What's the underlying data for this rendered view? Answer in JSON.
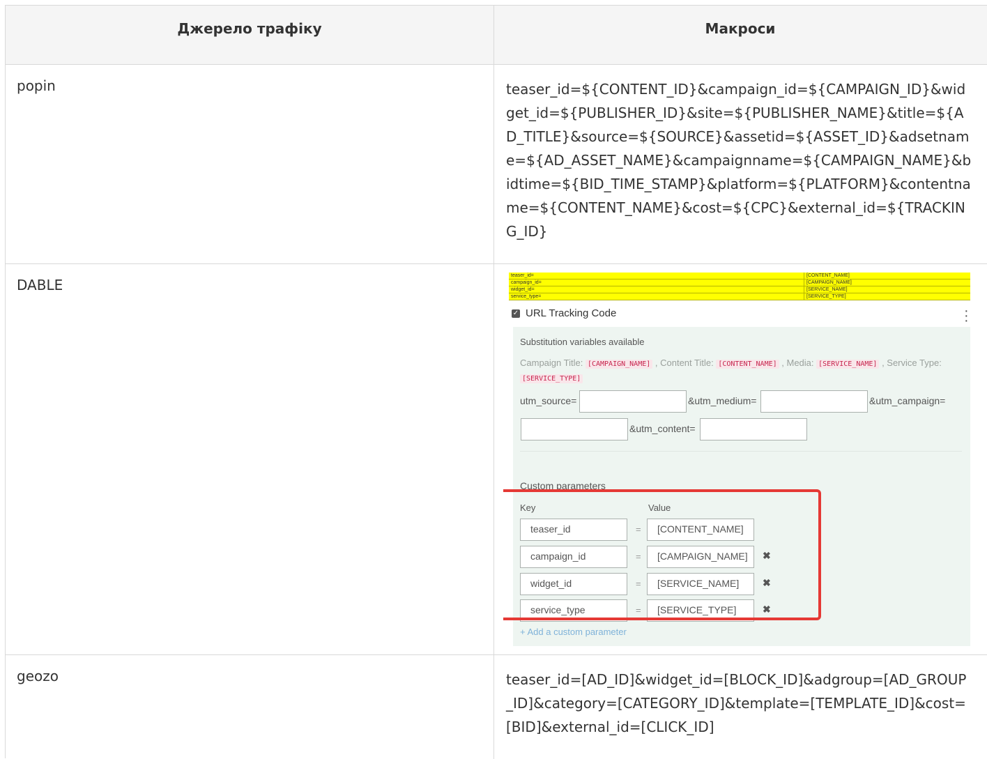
{
  "table": {
    "headers": [
      "Джерело трафіку",
      "Макроси"
    ],
    "rows": [
      {
        "source": "popin",
        "macros": "teaser_id=${CONTENT_ID}&campaign_id=${CAMPAIGN_ID}&widget_id=${PUBLISHER_ID}&site=${PUBLISHER_NAME}&title=${AD_TITLE}&source=${SOURCE}&assetid=${ASSET_ID}&adsetname=${AD_ASSET_NAME}&campaignname=${CAMPAIGN_NAME}&bidtime=${BID_TIME_STAMP}&platform=${PLATFORM}&contentname=${CONTENT_NAME}&cost=${CPC}&external_id=${TRACKING_ID}"
      },
      {
        "source": "DABLE",
        "macros": ""
      },
      {
        "source": "geozo",
        "macros": "teaser_id=[AD_ID]&widget_id=[BLOCK_ID]&adgroup=[AD_GROUP_ID]&category=[CATEGORY_ID]&template=[TEMPLATE_ID]&cost=[BID]&external_id=[CLICK_ID]"
      }
    ]
  },
  "dable_screenshot": {
    "yellow_table": [
      {
        "key": "teaser_id=",
        "value": "[CONTENT_NAME]"
      },
      {
        "key": "campaign_id=",
        "value": "[CAMPAIGN_NAME]"
      },
      {
        "key": "widget_id=",
        "value": "[SERVICE_NAME]"
      },
      {
        "key": "service_type=",
        "value": "[SERVICE_TYPE]"
      }
    ],
    "tracking_label": "URL Tracking Code",
    "subst_title": "Substitution variables available",
    "subst_vars": {
      "campaign_title_label": "Campaign Title:",
      "campaign_title_var": "[CAMPAIGN_NAME]",
      "content_title_label": ", Content Title:",
      "content_title_var": "[CONTENT_NAME]",
      "media_label": ", Media:",
      "media_var": "[SERVICE_NAME]",
      "service_type_label": ", Service Type:",
      "service_type_var": "[SERVICE_TYPE]"
    },
    "utm": {
      "source_label": "utm_source=",
      "medium_label": "&utm_medium=",
      "campaign_label": "&utm_campaign=",
      "content_label": "&utm_content="
    },
    "custom_title": "Custom parameters",
    "key_header": "Key",
    "value_header": "Value",
    "params": [
      {
        "key": "teaser_id",
        "value": "[CONTENT_NAME]"
      },
      {
        "key": "campaign_id",
        "value": "[CAMPAIGN_NAME]"
      },
      {
        "key": "widget_id",
        "value": "[SERVICE_NAME]"
      },
      {
        "key": "service_type",
        "value": "[SERVICE_TYPE]"
      }
    ],
    "equals": "=",
    "add_param": "+ Add a custom parameter",
    "icons": [
      "checkbox-icon",
      "kebab-menu-icon",
      "remove-icon"
    ],
    "colors": {
      "highlight": "#ffff00",
      "panel_bg": "#eef5f1",
      "red_box": "#e53935",
      "var_text": "#c7254e"
    }
  }
}
